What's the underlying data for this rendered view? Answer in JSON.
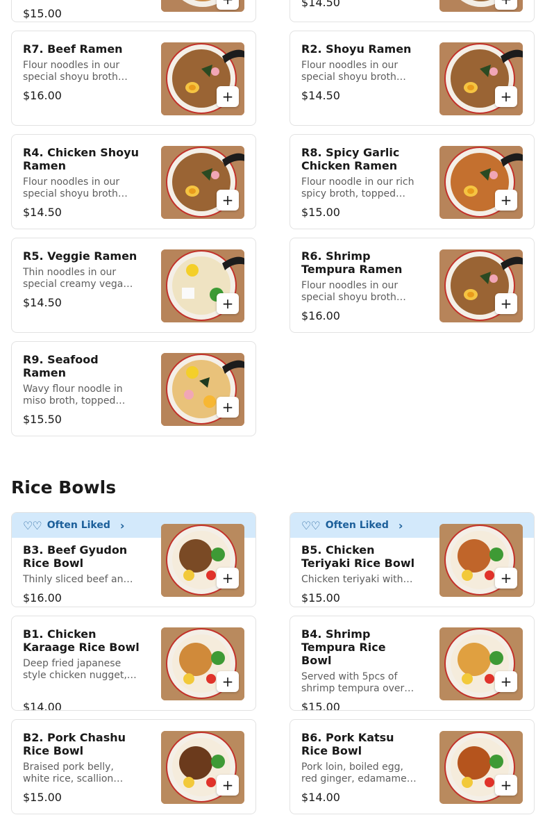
{
  "top_partial": {
    "left_price": "$15.00",
    "right_price": "$14.50"
  },
  "ramen": [
    {
      "title": "R7. Beef Ramen",
      "desc": "Flour noodles in our special shoyu broth…",
      "price": "$16.00",
      "bowl": "brown"
    },
    {
      "title": "R2. Shoyu Ramen",
      "desc": "Flour noodles in our special shoyu broth…",
      "price": "$14.50",
      "bowl": "brown"
    },
    {
      "title": "R4. Chicken Shoyu Ramen",
      "desc": "Flour noodles in our special shoyu broth…",
      "price": "$14.50",
      "bowl": "brown"
    },
    {
      "title": "R8. Spicy Garlic Chicken Ramen",
      "desc": "Flour noodle in our rich spicy broth, topped…",
      "price": "$15.00",
      "bowl": "orange"
    },
    {
      "title": "R5. Veggie Ramen",
      "desc": "Thin noodles in our special creamy vega…",
      "price": "$14.50",
      "bowl": "veggie"
    },
    {
      "title": "R6. Shrimp Tempura Ramen",
      "desc": "Flour noodles in our special shoyu broth…",
      "price": "$16.00",
      "bowl": "brown"
    },
    {
      "title": "R9. Seafood Ramen",
      "desc": "Wavy flour noodle in miso broth, topped…",
      "price": "$15.50",
      "bowl": "seafood"
    }
  ],
  "rice_section_title": "Rice Bowls",
  "often_liked_label": "Often Liked",
  "rice": [
    {
      "title": "B3. Beef Gyudon Rice Bowl",
      "desc": "Thinly sliced beef an…",
      "price": "$16.00",
      "liked": true
    },
    {
      "title": "B5. Chicken Teriyaki Rice Bowl",
      "desc": "Chicken teriyaki with…",
      "price": "$15.00",
      "liked": true
    },
    {
      "title": "B1. Chicken Karaage Rice Bowl",
      "desc": "Deep fried japanese style chicken nugget,…",
      "price": "$14.00",
      "liked": false
    },
    {
      "title": "B4. Shrimp Tempura Rice Bowl",
      "desc": "Served with 5pcs of shrimp tempura over…",
      "price": "$15.00",
      "liked": false
    },
    {
      "title": "B2. Pork Chashu Rice Bowl",
      "desc": "Braised pork belly, white rice, scallion…",
      "price": "$15.00",
      "liked": false
    },
    {
      "title": "B6. Pork Katsu Rice Bowl",
      "desc": "Pork loin, boiled egg, red ginger, edamame…",
      "price": "$14.00",
      "liked": false
    }
  ],
  "add_label": "+",
  "icons": {
    "add": "plus-icon",
    "liked": "hearts-icon",
    "chevron": "chevron-right-icon"
  }
}
